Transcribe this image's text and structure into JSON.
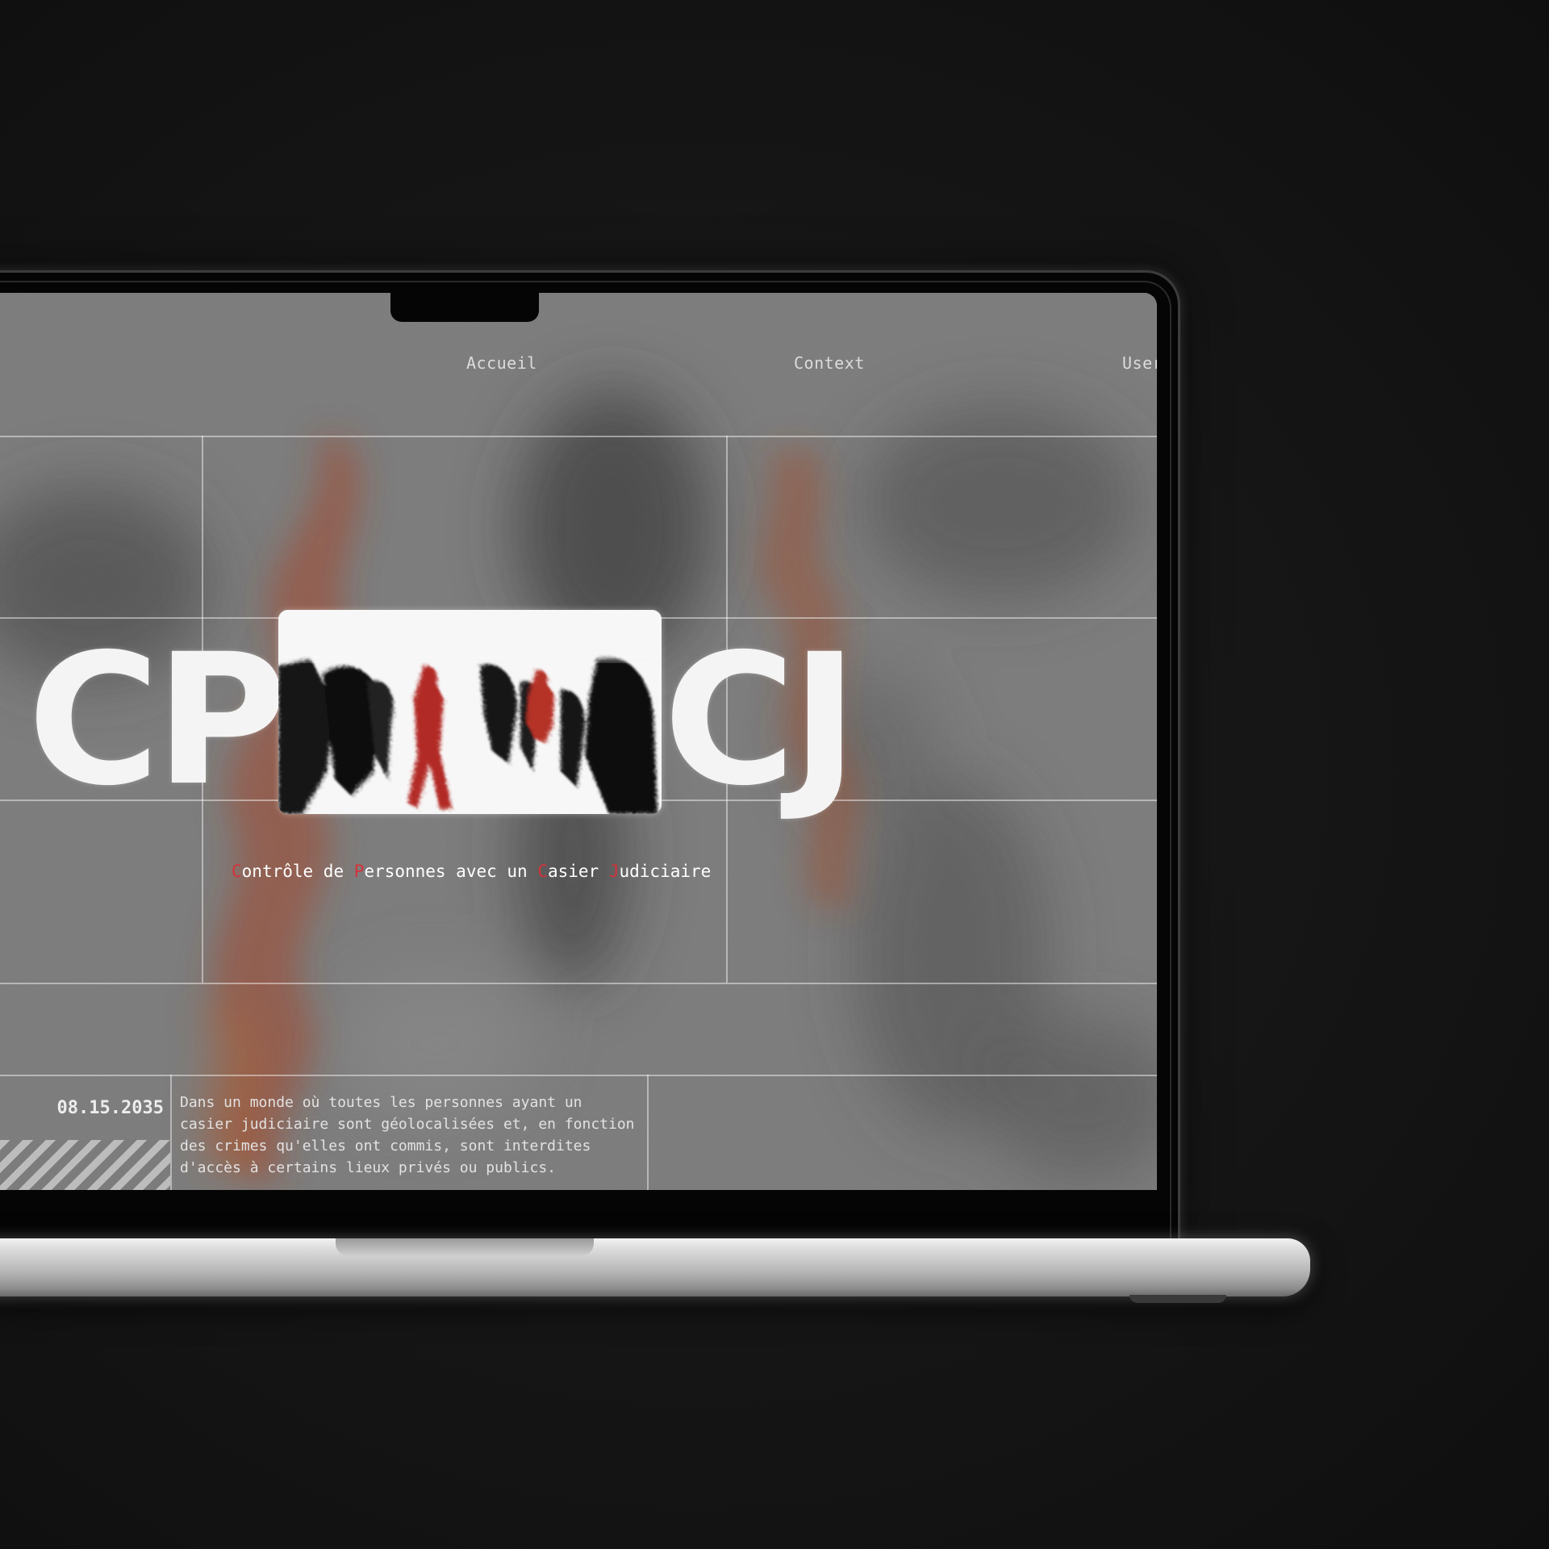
{
  "nav": {
    "items": [
      "Accueil",
      "Context",
      "User"
    ]
  },
  "logo": {
    "left_letters": "CP",
    "right_letters": "CJ"
  },
  "tagline": {
    "parts": [
      {
        "initial": "C",
        "rest": "ontrôle de "
      },
      {
        "initial": "P",
        "rest": "ersonnes avec un "
      },
      {
        "initial": "C",
        "rest": "asier "
      },
      {
        "initial": "J",
        "rest": "udiciaire"
      }
    ]
  },
  "info": {
    "date": "08.15.2035",
    "description": [
      "Dans un monde où toutes les personnes ayant un",
      "casier judiciaire sont géolocalisées et, en fonction",
      "des crimes qu'elles ont commis, sont interdites",
      "d'accès à certains lieux privés ou publics."
    ]
  },
  "colors": {
    "accent_red": "#d4323a",
    "screen_bg": "#7a7a7a",
    "text_light": "#f4f4f4"
  }
}
